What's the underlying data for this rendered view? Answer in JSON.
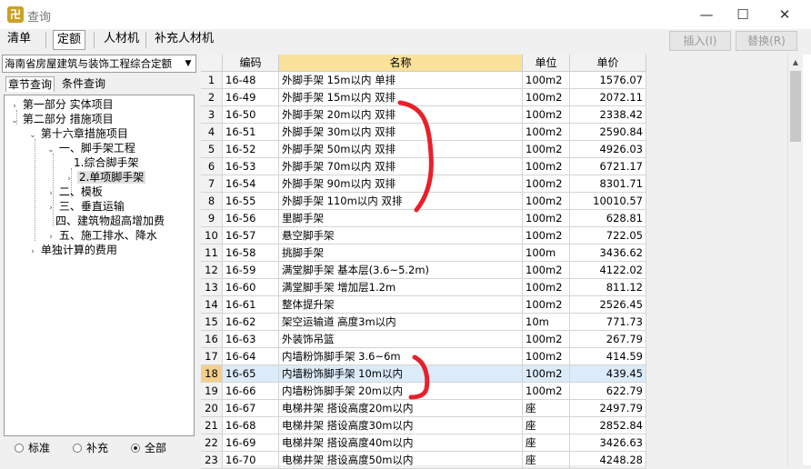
{
  "window": {
    "title": "查询",
    "app_icon": "app-logo-icon",
    "min_glyph": "—",
    "max_glyph": "☐",
    "close_glyph": "✕"
  },
  "toolbar": {
    "tabs": [
      {
        "label": "清单",
        "active": false
      },
      {
        "label": "定额",
        "active": true
      },
      {
        "label": "人材机",
        "active": false
      },
      {
        "label": "补充人材机",
        "active": false
      }
    ],
    "insert_label": "插入(I)",
    "replace_label": "替换(R)"
  },
  "left": {
    "combo_value": "海南省房屋建筑与装饰工程综合定额",
    "tabs": [
      "章节查询",
      "条件查询"
    ],
    "tree": [
      {
        "label": "第一部分 实体项目",
        "level": 0,
        "expander": "collapsed"
      },
      {
        "label": "第二部分 措施项目",
        "level": 0,
        "expander": "expanded"
      },
      {
        "label": "第十六章措施项目",
        "level": 1,
        "expander": "expanded"
      },
      {
        "label": "一、脚手架工程",
        "level": 2,
        "expander": "expanded"
      },
      {
        "label": "1.综合脚手架",
        "level": 3,
        "expander": "none"
      },
      {
        "label": "2.单项脚手架",
        "level": 3,
        "expander": "collapsed",
        "selected": true
      },
      {
        "label": "二、模板",
        "level": 2,
        "expander": "collapsed"
      },
      {
        "label": "三、垂直运输",
        "level": 2,
        "expander": "collapsed"
      },
      {
        "label": "四、建筑物超高增加费",
        "level": 2,
        "expander": "none"
      },
      {
        "label": "五、施工排水、降水",
        "level": 2,
        "expander": "collapsed"
      },
      {
        "label": "单独计算的费用",
        "level": 1,
        "expander": "collapsed"
      }
    ],
    "filters": [
      {
        "label": "标准",
        "checked": false
      },
      {
        "label": "补充",
        "checked": false
      },
      {
        "label": "全部",
        "checked": true
      }
    ]
  },
  "grid": {
    "columns": [
      "",
      "编码",
      "名称",
      "单位",
      "单价"
    ],
    "selected_row": 18,
    "rows": [
      {
        "n": "1",
        "code": "16-48",
        "name": "外脚手架 15m以内 单排",
        "unit": "100m2",
        "price": "1576.07"
      },
      {
        "n": "2",
        "code": "16-49",
        "name": "外脚手架 15m以内 双排",
        "unit": "100m2",
        "price": "2072.11"
      },
      {
        "n": "3",
        "code": "16-50",
        "name": "外脚手架 20m以内 双排",
        "unit": "100m2",
        "price": "2338.42"
      },
      {
        "n": "4",
        "code": "16-51",
        "name": "外脚手架 30m以内 双排",
        "unit": "100m2",
        "price": "2590.84"
      },
      {
        "n": "5",
        "code": "16-52",
        "name": "外脚手架 50m以内 双排",
        "unit": "100m2",
        "price": "4926.03"
      },
      {
        "n": "6",
        "code": "16-53",
        "name": "外脚手架 70m以内 双排",
        "unit": "100m2",
        "price": "6721.17"
      },
      {
        "n": "7",
        "code": "16-54",
        "name": "外脚手架 90m以内 双排",
        "unit": "100m2",
        "price": "8301.71"
      },
      {
        "n": "8",
        "code": "16-55",
        "name": "外脚手架 110m以内 双排",
        "unit": "100m2",
        "price": "10010.57"
      },
      {
        "n": "9",
        "code": "16-56",
        "name": "里脚手架",
        "unit": "100m2",
        "price": "628.81"
      },
      {
        "n": "10",
        "code": "16-57",
        "name": "悬空脚手架",
        "unit": "100m2",
        "price": "722.05"
      },
      {
        "n": "11",
        "code": "16-58",
        "name": "挑脚手架",
        "unit": "100m",
        "price": "3436.62"
      },
      {
        "n": "12",
        "code": "16-59",
        "name": "满堂脚手架 基本层(3.6~5.2m)",
        "unit": "100m2",
        "price": "4122.02"
      },
      {
        "n": "13",
        "code": "16-60",
        "name": "满堂脚手架 增加层1.2m",
        "unit": "100m2",
        "price": "811.12"
      },
      {
        "n": "14",
        "code": "16-61",
        "name": "整体提升架",
        "unit": "100m2",
        "price": "2526.45"
      },
      {
        "n": "15",
        "code": "16-62",
        "name": "架空运输道 高度3m以内",
        "unit": "10m",
        "price": "771.73"
      },
      {
        "n": "16",
        "code": "16-63",
        "name": "外装饰吊篮",
        "unit": "100m2",
        "price": "267.79"
      },
      {
        "n": "17",
        "code": "16-64",
        "name": "内墙粉饰脚手架 3.6~6m",
        "unit": "100m2",
        "price": "414.59"
      },
      {
        "n": "18",
        "code": "16-65",
        "name": "内墙粉饰脚手架 10m以内",
        "unit": "100m2",
        "price": "439.45"
      },
      {
        "n": "19",
        "code": "16-66",
        "name": "内墙粉饰脚手架 20m以内",
        "unit": "100m2",
        "price": "622.79"
      },
      {
        "n": "20",
        "code": "16-67",
        "name": "电梯井架 搭设高度20m以内",
        "unit": "座",
        "price": "2497.79"
      },
      {
        "n": "21",
        "code": "16-68",
        "name": "电梯井架 搭设高度30m以内",
        "unit": "座",
        "price": "2852.84"
      },
      {
        "n": "22",
        "code": "16-69",
        "name": "电梯井架 搭设高度40m以内",
        "unit": "座",
        "price": "3426.63"
      },
      {
        "n": "23",
        "code": "16-70",
        "name": "电梯井架 搭设高度50m以内",
        "unit": "座",
        "price": "4248.28"
      }
    ]
  },
  "annotation": {
    "color": "#e8202a"
  }
}
